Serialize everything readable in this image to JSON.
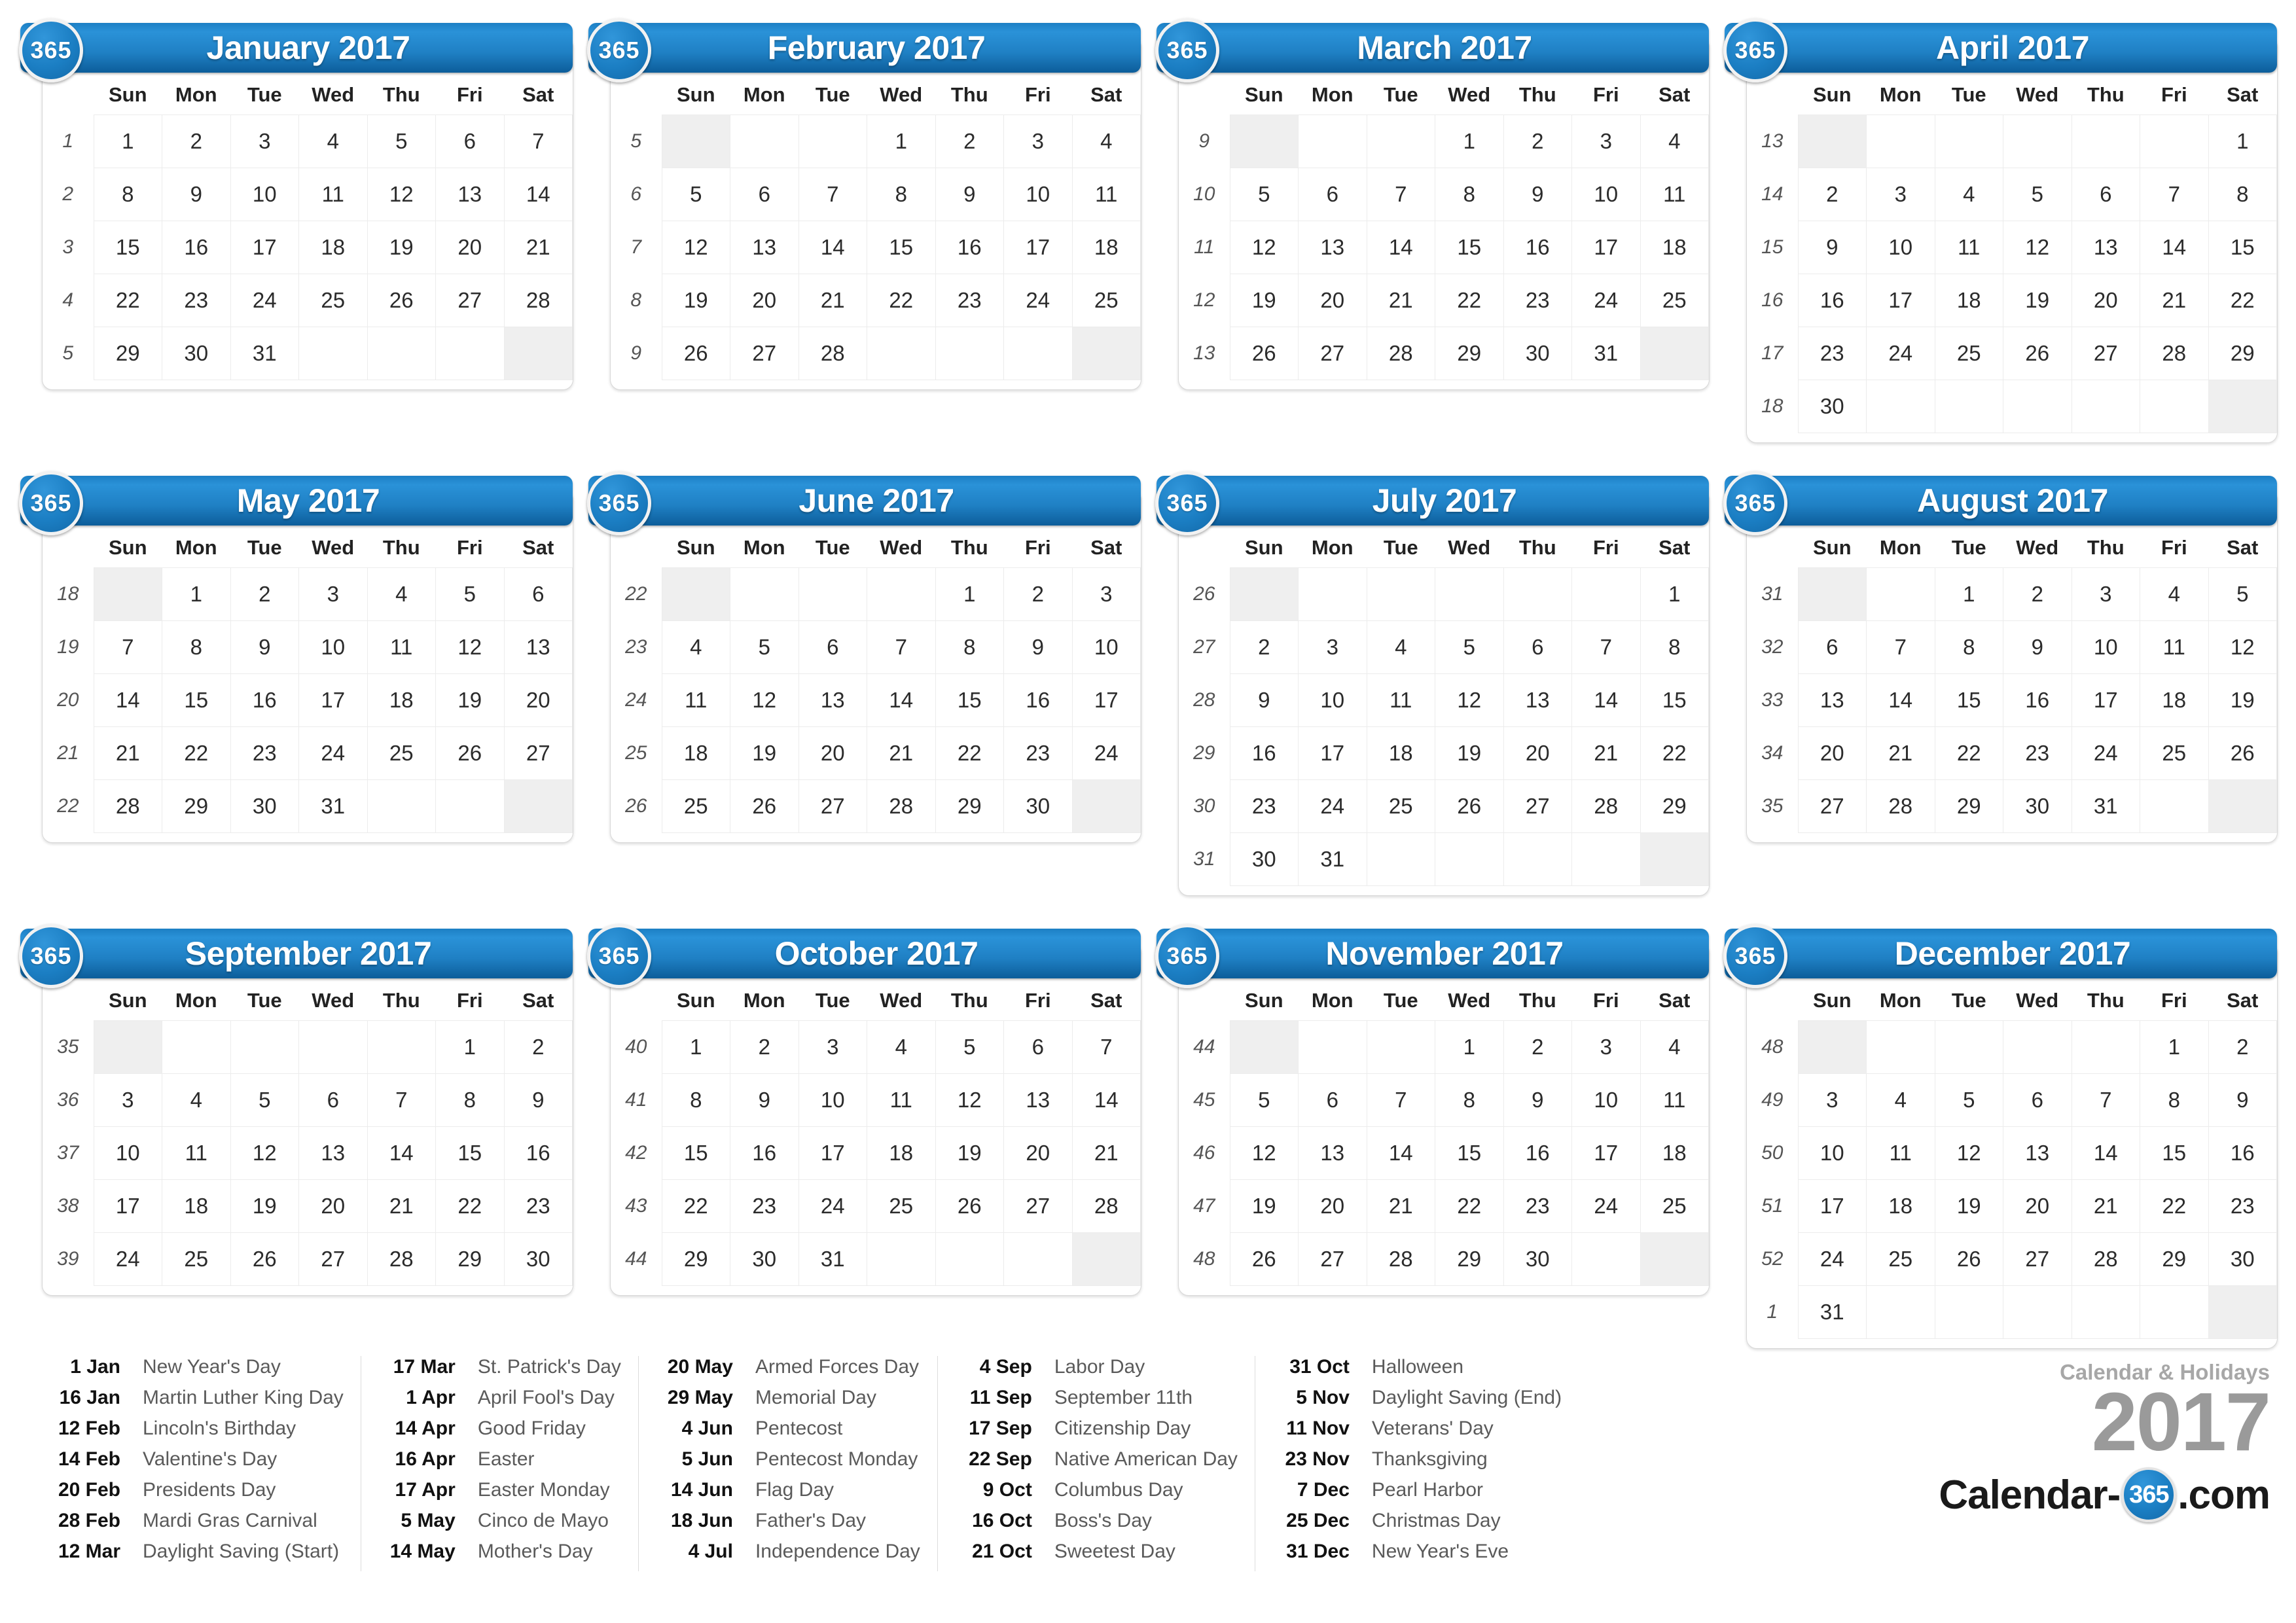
{
  "brand": {
    "subtitle": "Calendar & Holidays",
    "year": "2017",
    "domain_pre": "Calendar-",
    "domain_badge": "365",
    "domain_post": ".com",
    "badge_label": "365",
    "accent_blue": "#1f80c4",
    "highlight_blue": "#d3e8fb",
    "weekend_gray": "#efefef"
  },
  "weekday_headers": [
    "Sun",
    "Mon",
    "Tue",
    "Wed",
    "Thu",
    "Fri",
    "Sat"
  ],
  "months": [
    {
      "title": "January 2017",
      "weeks": [
        {
          "no": "1",
          "days": [
            "1",
            "2",
            "3",
            "4",
            "5",
            "6",
            "7"
          ],
          "hl": [
            1
          ]
        },
        {
          "no": "2",
          "days": [
            "8",
            "9",
            "10",
            "11",
            "12",
            "13",
            "14"
          ],
          "hl": []
        },
        {
          "no": "3",
          "days": [
            "15",
            "16",
            "17",
            "18",
            "19",
            "20",
            "21"
          ],
          "hl": [
            16
          ]
        },
        {
          "no": "4",
          "days": [
            "22",
            "23",
            "24",
            "25",
            "26",
            "27",
            "28"
          ],
          "hl": []
        },
        {
          "no": "5",
          "days": [
            "29",
            "30",
            "31",
            "",
            "",
            "",
            ""
          ],
          "hl": []
        }
      ]
    },
    {
      "title": "February 2017",
      "weeks": [
        {
          "no": "5",
          "days": [
            "",
            "",
            "",
            "1",
            "2",
            "3",
            "4"
          ],
          "hl": []
        },
        {
          "no": "6",
          "days": [
            "5",
            "6",
            "7",
            "8",
            "9",
            "10",
            "11"
          ],
          "hl": []
        },
        {
          "no": "7",
          "days": [
            "12",
            "13",
            "14",
            "15",
            "16",
            "17",
            "18"
          ],
          "hl": [
            12,
            14
          ]
        },
        {
          "no": "8",
          "days": [
            "19",
            "20",
            "21",
            "22",
            "23",
            "24",
            "25"
          ],
          "hl": [
            20
          ]
        },
        {
          "no": "9",
          "days": [
            "26",
            "27",
            "28",
            "",
            "",
            "",
            ""
          ],
          "hl": [
            28
          ]
        }
      ]
    },
    {
      "title": "March 2017",
      "weeks": [
        {
          "no": "9",
          "days": [
            "",
            "",
            "",
            "1",
            "2",
            "3",
            "4"
          ],
          "hl": []
        },
        {
          "no": "10",
          "days": [
            "5",
            "6",
            "7",
            "8",
            "9",
            "10",
            "11"
          ],
          "hl": []
        },
        {
          "no": "11",
          "days": [
            "12",
            "13",
            "14",
            "15",
            "16",
            "17",
            "18"
          ],
          "hl": [
            12,
            17
          ]
        },
        {
          "no": "12",
          "days": [
            "19",
            "20",
            "21",
            "22",
            "23",
            "24",
            "25"
          ],
          "hl": []
        },
        {
          "no": "13",
          "days": [
            "26",
            "27",
            "28",
            "29",
            "30",
            "31",
            ""
          ],
          "hl": []
        }
      ]
    },
    {
      "title": "April 2017",
      "weeks": [
        {
          "no": "13",
          "days": [
            "",
            "",
            "",
            "",
            "",
            "",
            "1"
          ],
          "hl": [
            1
          ]
        },
        {
          "no": "14",
          "days": [
            "2",
            "3",
            "4",
            "5",
            "6",
            "7",
            "8"
          ],
          "hl": []
        },
        {
          "no": "15",
          "days": [
            "9",
            "10",
            "11",
            "12",
            "13",
            "14",
            "15"
          ],
          "hl": [
            14
          ]
        },
        {
          "no": "16",
          "days": [
            "16",
            "17",
            "18",
            "19",
            "20",
            "21",
            "22"
          ],
          "hl": [
            16,
            17
          ]
        },
        {
          "no": "17",
          "days": [
            "23",
            "24",
            "25",
            "26",
            "27",
            "28",
            "29"
          ],
          "hl": []
        },
        {
          "no": "18",
          "days": [
            "30",
            "",
            "",
            "",
            "",
            "",
            ""
          ],
          "hl": []
        }
      ]
    },
    {
      "title": "May 2017",
      "weeks": [
        {
          "no": "18",
          "days": [
            "",
            "1",
            "2",
            "3",
            "4",
            "5",
            "6"
          ],
          "hl": [
            5
          ]
        },
        {
          "no": "19",
          "days": [
            "7",
            "8",
            "9",
            "10",
            "11",
            "12",
            "13"
          ],
          "hl": []
        },
        {
          "no": "20",
          "days": [
            "14",
            "15",
            "16",
            "17",
            "18",
            "19",
            "20"
          ],
          "hl": [
            14,
            20
          ]
        },
        {
          "no": "21",
          "days": [
            "21",
            "22",
            "23",
            "24",
            "25",
            "26",
            "27"
          ],
          "hl": []
        },
        {
          "no": "22",
          "days": [
            "28",
            "29",
            "30",
            "31",
            "",
            "",
            ""
          ],
          "hl": [
            29
          ]
        }
      ]
    },
    {
      "title": "June 2017",
      "weeks": [
        {
          "no": "22",
          "days": [
            "",
            "",
            "",
            "",
            "1",
            "2",
            "3"
          ],
          "hl": []
        },
        {
          "no": "23",
          "days": [
            "4",
            "5",
            "6",
            "7",
            "8",
            "9",
            "10"
          ],
          "hl": [
            4,
            5
          ]
        },
        {
          "no": "24",
          "days": [
            "11",
            "12",
            "13",
            "14",
            "15",
            "16",
            "17"
          ],
          "hl": [
            14
          ]
        },
        {
          "no": "25",
          "days": [
            "18",
            "19",
            "20",
            "21",
            "22",
            "23",
            "24"
          ],
          "hl": [
            18
          ]
        },
        {
          "no": "26",
          "days": [
            "25",
            "26",
            "27",
            "28",
            "29",
            "30",
            ""
          ],
          "hl": []
        }
      ]
    },
    {
      "title": "July 2017",
      "weeks": [
        {
          "no": "26",
          "days": [
            "",
            "",
            "",
            "",
            "",
            "",
            "1"
          ],
          "hl": []
        },
        {
          "no": "27",
          "days": [
            "2",
            "3",
            "4",
            "5",
            "6",
            "7",
            "8"
          ],
          "hl": [
            4
          ]
        },
        {
          "no": "28",
          "days": [
            "9",
            "10",
            "11",
            "12",
            "13",
            "14",
            "15"
          ],
          "hl": []
        },
        {
          "no": "29",
          "days": [
            "16",
            "17",
            "18",
            "19",
            "20",
            "21",
            "22"
          ],
          "hl": []
        },
        {
          "no": "30",
          "days": [
            "23",
            "24",
            "25",
            "26",
            "27",
            "28",
            "29"
          ],
          "hl": []
        },
        {
          "no": "31",
          "days": [
            "30",
            "31",
            "",
            "",
            "",
            "",
            ""
          ],
          "hl": []
        }
      ]
    },
    {
      "title": "August 2017",
      "weeks": [
        {
          "no": "31",
          "days": [
            "",
            "",
            "1",
            "2",
            "3",
            "4",
            "5"
          ],
          "hl": []
        },
        {
          "no": "32",
          "days": [
            "6",
            "7",
            "8",
            "9",
            "10",
            "11",
            "12"
          ],
          "hl": []
        },
        {
          "no": "33",
          "days": [
            "13",
            "14",
            "15",
            "16",
            "17",
            "18",
            "19"
          ],
          "hl": []
        },
        {
          "no": "34",
          "days": [
            "20",
            "21",
            "22",
            "23",
            "24",
            "25",
            "26"
          ],
          "hl": []
        },
        {
          "no": "35",
          "days": [
            "27",
            "28",
            "29",
            "30",
            "31",
            "",
            ""
          ],
          "hl": []
        }
      ]
    },
    {
      "title": "September 2017",
      "weeks": [
        {
          "no": "35",
          "days": [
            "",
            "",
            "",
            "",
            "",
            "1",
            "2"
          ],
          "hl": []
        },
        {
          "no": "36",
          "days": [
            "3",
            "4",
            "5",
            "6",
            "7",
            "8",
            "9"
          ],
          "hl": [
            4
          ]
        },
        {
          "no": "37",
          "days": [
            "10",
            "11",
            "12",
            "13",
            "14",
            "15",
            "16"
          ],
          "hl": [
            11
          ]
        },
        {
          "no": "38",
          "days": [
            "17",
            "18",
            "19",
            "20",
            "21",
            "22",
            "23"
          ],
          "hl": [
            17,
            22
          ]
        },
        {
          "no": "39",
          "days": [
            "24",
            "25",
            "26",
            "27",
            "28",
            "29",
            "30"
          ],
          "hl": []
        }
      ]
    },
    {
      "title": "October 2017",
      "weeks": [
        {
          "no": "40",
          "days": [
            "1",
            "2",
            "3",
            "4",
            "5",
            "6",
            "7"
          ],
          "hl": []
        },
        {
          "no": "41",
          "days": [
            "8",
            "9",
            "10",
            "11",
            "12",
            "13",
            "14"
          ],
          "hl": [
            9
          ]
        },
        {
          "no": "42",
          "days": [
            "15",
            "16",
            "17",
            "18",
            "19",
            "20",
            "21"
          ],
          "hl": [
            16,
            21
          ]
        },
        {
          "no": "43",
          "days": [
            "22",
            "23",
            "24",
            "25",
            "26",
            "27",
            "28"
          ],
          "hl": []
        },
        {
          "no": "44",
          "days": [
            "29",
            "30",
            "31",
            "",
            "",
            "",
            ""
          ],
          "hl": [
            31
          ]
        }
      ]
    },
    {
      "title": "November 2017",
      "weeks": [
        {
          "no": "44",
          "days": [
            "",
            "",
            "",
            "1",
            "2",
            "3",
            "4"
          ],
          "hl": []
        },
        {
          "no": "45",
          "days": [
            "5",
            "6",
            "7",
            "8",
            "9",
            "10",
            "11"
          ],
          "hl": [
            5,
            11
          ]
        },
        {
          "no": "46",
          "days": [
            "12",
            "13",
            "14",
            "15",
            "16",
            "17",
            "18"
          ],
          "hl": []
        },
        {
          "no": "47",
          "days": [
            "19",
            "20",
            "21",
            "22",
            "23",
            "24",
            "25"
          ],
          "hl": [
            23
          ]
        },
        {
          "no": "48",
          "days": [
            "26",
            "27",
            "28",
            "29",
            "30",
            "",
            ""
          ],
          "hl": []
        }
      ]
    },
    {
      "title": "December 2017",
      "weeks": [
        {
          "no": "48",
          "days": [
            "",
            "",
            "",
            "",
            "",
            "1",
            "2"
          ],
          "hl": []
        },
        {
          "no": "49",
          "days": [
            "3",
            "4",
            "5",
            "6",
            "7",
            "8",
            "9"
          ],
          "hl": [
            7
          ]
        },
        {
          "no": "50",
          "days": [
            "10",
            "11",
            "12",
            "13",
            "14",
            "15",
            "16"
          ],
          "hl": []
        },
        {
          "no": "51",
          "days": [
            "17",
            "18",
            "19",
            "20",
            "21",
            "22",
            "23"
          ],
          "hl": []
        },
        {
          "no": "52",
          "days": [
            "24",
            "25",
            "26",
            "27",
            "28",
            "29",
            "30"
          ],
          "hl": [
            25
          ]
        },
        {
          "no": "1",
          "days": [
            "31",
            "",
            "",
            "",
            "",
            "",
            ""
          ],
          "hl": [
            31
          ]
        }
      ]
    }
  ],
  "holiday_columns": [
    [
      {
        "date": "1 Jan",
        "name": "New Year's Day"
      },
      {
        "date": "16 Jan",
        "name": "Martin Luther King Day"
      },
      {
        "date": "12 Feb",
        "name": "Lincoln's Birthday"
      },
      {
        "date": "14 Feb",
        "name": "Valentine's Day"
      },
      {
        "date": "20 Feb",
        "name": "Presidents Day"
      },
      {
        "date": "28 Feb",
        "name": "Mardi Gras Carnival"
      },
      {
        "date": "12 Mar",
        "name": "Daylight Saving (Start)"
      }
    ],
    [
      {
        "date": "17 Mar",
        "name": "St. Patrick's Day"
      },
      {
        "date": "1 Apr",
        "name": "April Fool's Day"
      },
      {
        "date": "14 Apr",
        "name": "Good Friday"
      },
      {
        "date": "16 Apr",
        "name": "Easter"
      },
      {
        "date": "17 Apr",
        "name": "Easter Monday"
      },
      {
        "date": "5 May",
        "name": "Cinco de Mayo"
      },
      {
        "date": "14 May",
        "name": "Mother's Day"
      }
    ],
    [
      {
        "date": "20 May",
        "name": "Armed Forces Day"
      },
      {
        "date": "29 May",
        "name": "Memorial Day"
      },
      {
        "date": "4 Jun",
        "name": "Pentecost"
      },
      {
        "date": "5 Jun",
        "name": "Pentecost Monday"
      },
      {
        "date": "14 Jun",
        "name": "Flag Day"
      },
      {
        "date": "18 Jun",
        "name": "Father's Day"
      },
      {
        "date": "4 Jul",
        "name": "Independence Day"
      }
    ],
    [
      {
        "date": "4 Sep",
        "name": "Labor Day"
      },
      {
        "date": "11 Sep",
        "name": "September 11th"
      },
      {
        "date": "17 Sep",
        "name": "Citizenship Day"
      },
      {
        "date": "22 Sep",
        "name": "Native American Day"
      },
      {
        "date": "9 Oct",
        "name": "Columbus Day"
      },
      {
        "date": "16 Oct",
        "name": "Boss's Day"
      },
      {
        "date": "21 Oct",
        "name": "Sweetest Day"
      }
    ],
    [
      {
        "date": "31 Oct",
        "name": "Halloween"
      },
      {
        "date": "5 Nov",
        "name": "Daylight Saving (End)"
      },
      {
        "date": "11 Nov",
        "name": "Veterans' Day"
      },
      {
        "date": "23 Nov",
        "name": "Thanksgiving"
      },
      {
        "date": "7 Dec",
        "name": "Pearl Harbor"
      },
      {
        "date": "25 Dec",
        "name": "Christmas Day"
      },
      {
        "date": "31 Dec",
        "name": "New Year's Eve"
      }
    ]
  ]
}
